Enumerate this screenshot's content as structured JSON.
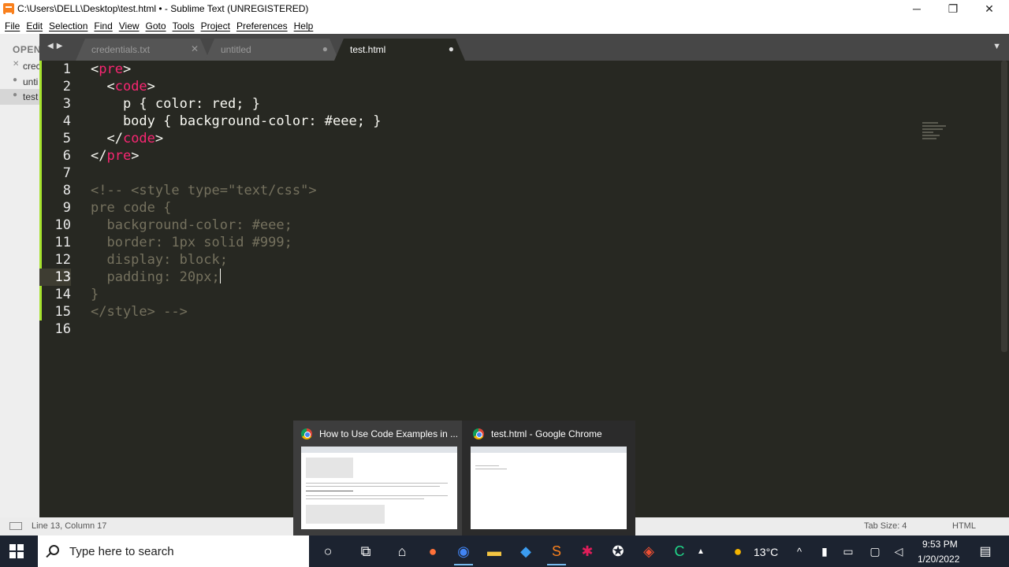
{
  "window": {
    "title": "C:\\Users\\DELL\\Desktop\\test.html • - Sublime Text (UNREGISTERED)",
    "minimize": "─",
    "maximize": "❐",
    "close": "✕"
  },
  "menu": [
    "File",
    "Edit",
    "Selection",
    "Find",
    "View",
    "Goto",
    "Tools",
    "Project",
    "Preferences",
    "Help"
  ],
  "sidebar": {
    "header": "OPEN",
    "files": [
      {
        "mark": "✕",
        "name": "crec"
      },
      {
        "mark": "●",
        "name": "unti"
      },
      {
        "mark": "●",
        "name": "test"
      }
    ]
  },
  "tabs": [
    {
      "label": "credentials.txt",
      "control": "✕"
    },
    {
      "label": "untitled",
      "control": "●"
    },
    {
      "label": "test.html",
      "control": "●"
    }
  ],
  "editor": {
    "lines": [
      {
        "n": "1",
        "parts": [
          {
            "t": "<"
          },
          {
            "t": "pre",
            "c": "tag"
          },
          {
            "t": ">"
          }
        ]
      },
      {
        "n": "2",
        "parts": [
          {
            "t": "  <"
          },
          {
            "t": "code",
            "c": "tag"
          },
          {
            "t": ">"
          }
        ]
      },
      {
        "n": "3",
        "parts": [
          {
            "t": "    p { color: red; }"
          }
        ]
      },
      {
        "n": "4",
        "parts": [
          {
            "t": "    body { background-color: #eee; }"
          }
        ]
      },
      {
        "n": "5",
        "parts": [
          {
            "t": "  </"
          },
          {
            "t": "code",
            "c": "tag"
          },
          {
            "t": ">"
          }
        ]
      },
      {
        "n": "6",
        "parts": [
          {
            "t": "</"
          },
          {
            "t": "pre",
            "c": "tag"
          },
          {
            "t": ">"
          }
        ]
      },
      {
        "n": "7",
        "parts": []
      },
      {
        "n": "8",
        "parts": [
          {
            "t": "<!-- <style type=\"text/css\">",
            "c": "cmt"
          }
        ]
      },
      {
        "n": "9",
        "parts": [
          {
            "t": "pre code {",
            "c": "cmt"
          }
        ]
      },
      {
        "n": "10",
        "parts": [
          {
            "t": "  background-color: #eee;",
            "c": "cmt"
          }
        ]
      },
      {
        "n": "11",
        "parts": [
          {
            "t": "  border: 1px solid #999;",
            "c": "cmt"
          }
        ]
      },
      {
        "n": "12",
        "parts": [
          {
            "t": "  display: block;",
            "c": "cmt"
          }
        ]
      },
      {
        "n": "13",
        "parts": [
          {
            "t": "  padding: 20px;",
            "c": "cmt"
          }
        ],
        "current": true
      },
      {
        "n": "14",
        "parts": [
          {
            "t": "}",
            "c": "cmt"
          }
        ]
      },
      {
        "n": "15",
        "parts": [
          {
            "t": "</style> -->",
            "c": "cmt"
          }
        ]
      },
      {
        "n": "16",
        "parts": []
      }
    ]
  },
  "status": {
    "position": "Line 13, Column 17",
    "tab_size": "Tab Size: 4",
    "syntax": "HTML"
  },
  "thumbnails": [
    {
      "title": "How to Use Code Examples in ..."
    },
    {
      "title": "test.html - Google Chrome"
    }
  ],
  "taskbar": {
    "search_placeholder": "Type here to search",
    "weather": "13°C",
    "time": "9:53 PM",
    "date": "1/20/2022"
  },
  "colors": {
    "editor_bg": "#272822",
    "tag": "#f92672",
    "comment": "#75715e",
    "modified_bar": "#a6e22e"
  }
}
